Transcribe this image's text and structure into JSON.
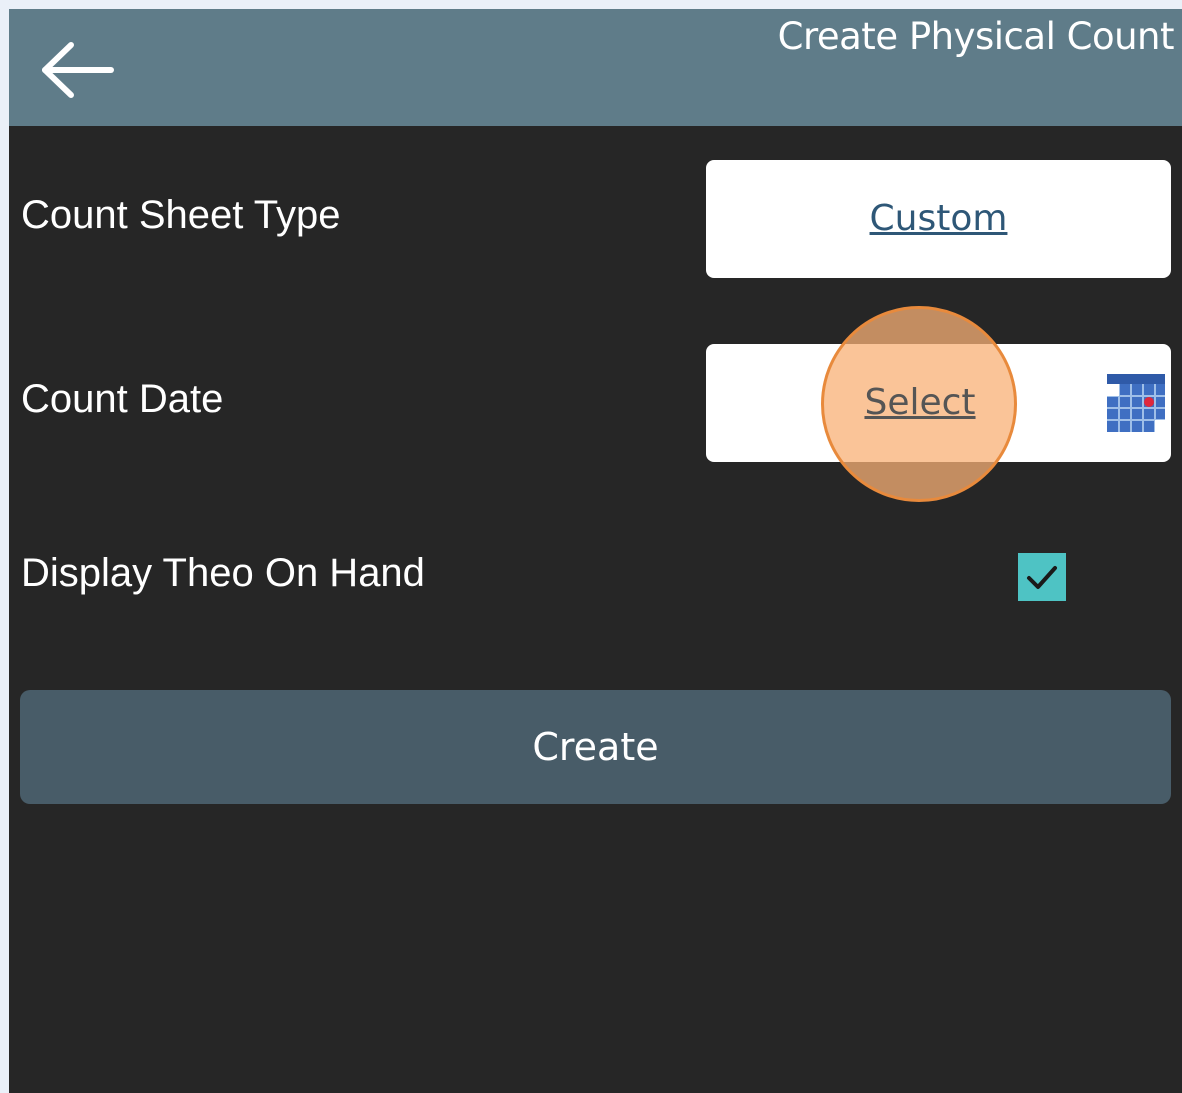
{
  "header": {
    "title": "Create Physical Count",
    "back_icon": "arrow-left-icon",
    "background_color": "#5f7c89"
  },
  "form": {
    "count_sheet_type": {
      "label": "Count Sheet Type",
      "value": "Custom"
    },
    "count_date": {
      "label": "Count Date",
      "value": "Select",
      "icon": "calendar-icon"
    },
    "display_theo_on_hand": {
      "label": "Display Theo On Hand",
      "checked": true,
      "check_color": "#4ec3c4"
    }
  },
  "actions": {
    "create_label": "Create",
    "create_color": "#485c68"
  },
  "click_marker_color": "#f8b076"
}
